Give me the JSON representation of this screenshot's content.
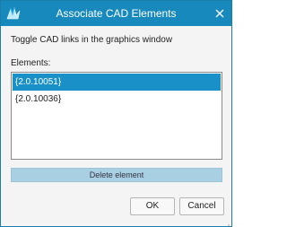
{
  "window": {
    "title": "Associate CAD Elements",
    "app_icon": "app-logo-icon",
    "close_icon": "close-icon"
  },
  "instruction": "Toggle CAD links in the graphics window",
  "elements_label": "Elements:",
  "elements": [
    {
      "label": "{2.0.10051}",
      "selected": true
    },
    {
      "label": "{2.0.10036}",
      "selected": false
    }
  ],
  "buttons": {
    "delete": "Delete element",
    "ok": "OK",
    "cancel": "Cancel"
  },
  "colors": {
    "titlebar": "#1789bd",
    "selection": "#1990c7",
    "delete_button": "#a9cfe2"
  }
}
